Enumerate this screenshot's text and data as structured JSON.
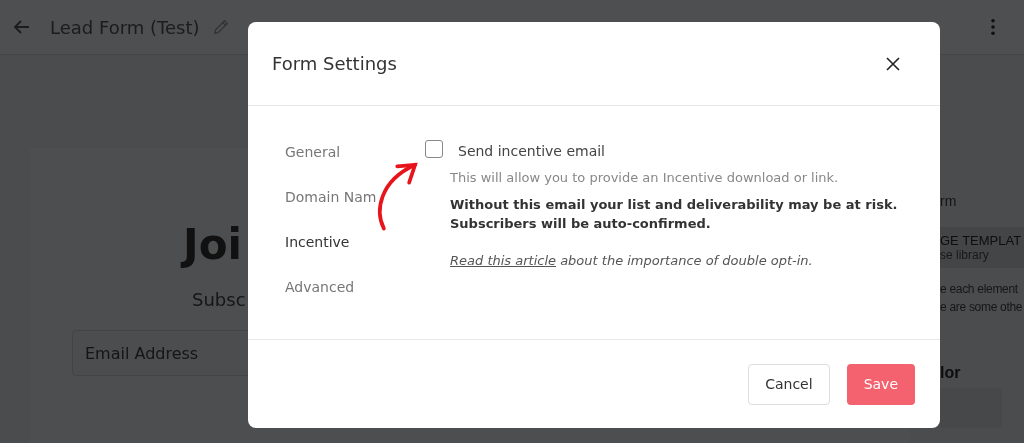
{
  "header": {
    "title": "Lead Form (Test)"
  },
  "canvas": {
    "heading": "Joi",
    "subheading": "Subsc",
    "email_field": {
      "placeholder": "Email Address"
    }
  },
  "side_panel": {
    "line_1": "rm",
    "template_title": "GE TEMPLAT",
    "template_subtitle": "se library",
    "paragraph": [
      "e each element",
      "e are some othe"
    ],
    "color_label": "lor"
  },
  "dialog": {
    "title": "Form Settings",
    "nav": [
      {
        "label": "General",
        "selected": false
      },
      {
        "label": "Domain Nam",
        "selected": false
      },
      {
        "label": "Incentive",
        "selected": true
      },
      {
        "label": "Advanced",
        "selected": false
      }
    ],
    "option": {
      "label": "Send incentive email",
      "checked": false
    },
    "description": "This will allow you to provide an Incentive download or link.",
    "warning": [
      "Without this email your list and deliverability may be at risk.",
      "Subscribers will be auto-confirmed."
    ],
    "note": {
      "link": "Read this article",
      "text": " about the importance of double opt-in."
    },
    "buttons": [
      {
        "label": "Cancel",
        "kind": "secondary"
      },
      {
        "label": "Save",
        "kind": "primary"
      }
    ]
  }
}
